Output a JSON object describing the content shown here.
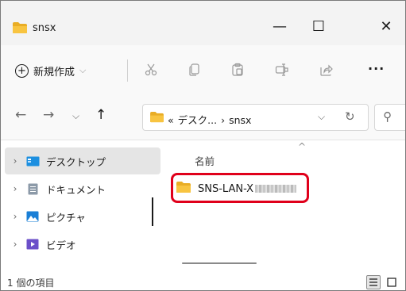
{
  "window": {
    "title": "snsx",
    "minimize_glyph": "—",
    "maximize_glyph": "☐",
    "close_glyph": "✕"
  },
  "toolbar": {
    "new_label": "新規作成",
    "new_chevron": "⌵",
    "more_glyph": "···",
    "icons": [
      "cut-icon",
      "copy-icon",
      "paste-icon",
      "rename-icon",
      "share-icon"
    ]
  },
  "address_bar": {
    "overflow": "«",
    "crumbs": [
      "デスク...",
      "›",
      "snsx"
    ],
    "dropdown_glyph": "⌵",
    "refresh_glyph": "↻"
  },
  "nav_buttons": {
    "back": "←",
    "forward": "→",
    "recent": "⌵",
    "up": "↑"
  },
  "nav_pane": {
    "items": [
      {
        "label": "デスクトップ",
        "icon": "desktop-icon",
        "selected": true
      },
      {
        "label": "ドキュメント",
        "icon": "documents-icon",
        "selected": false
      },
      {
        "label": "ピクチャ",
        "icon": "pictures-icon",
        "selected": false
      },
      {
        "label": "ビデオ",
        "icon": "videos-icon",
        "selected": false
      }
    ],
    "expander": "›"
  },
  "content": {
    "column_name": "名前",
    "sort_glyph": "^",
    "files": [
      {
        "name": "SNS-LAN-X",
        "type": "folder"
      }
    ]
  },
  "status": {
    "item_count": "1 個の項目"
  },
  "colors": {
    "folder": "#f8c440",
    "highlight": "#e0001b",
    "selected_bg": "#e5e5e5"
  }
}
